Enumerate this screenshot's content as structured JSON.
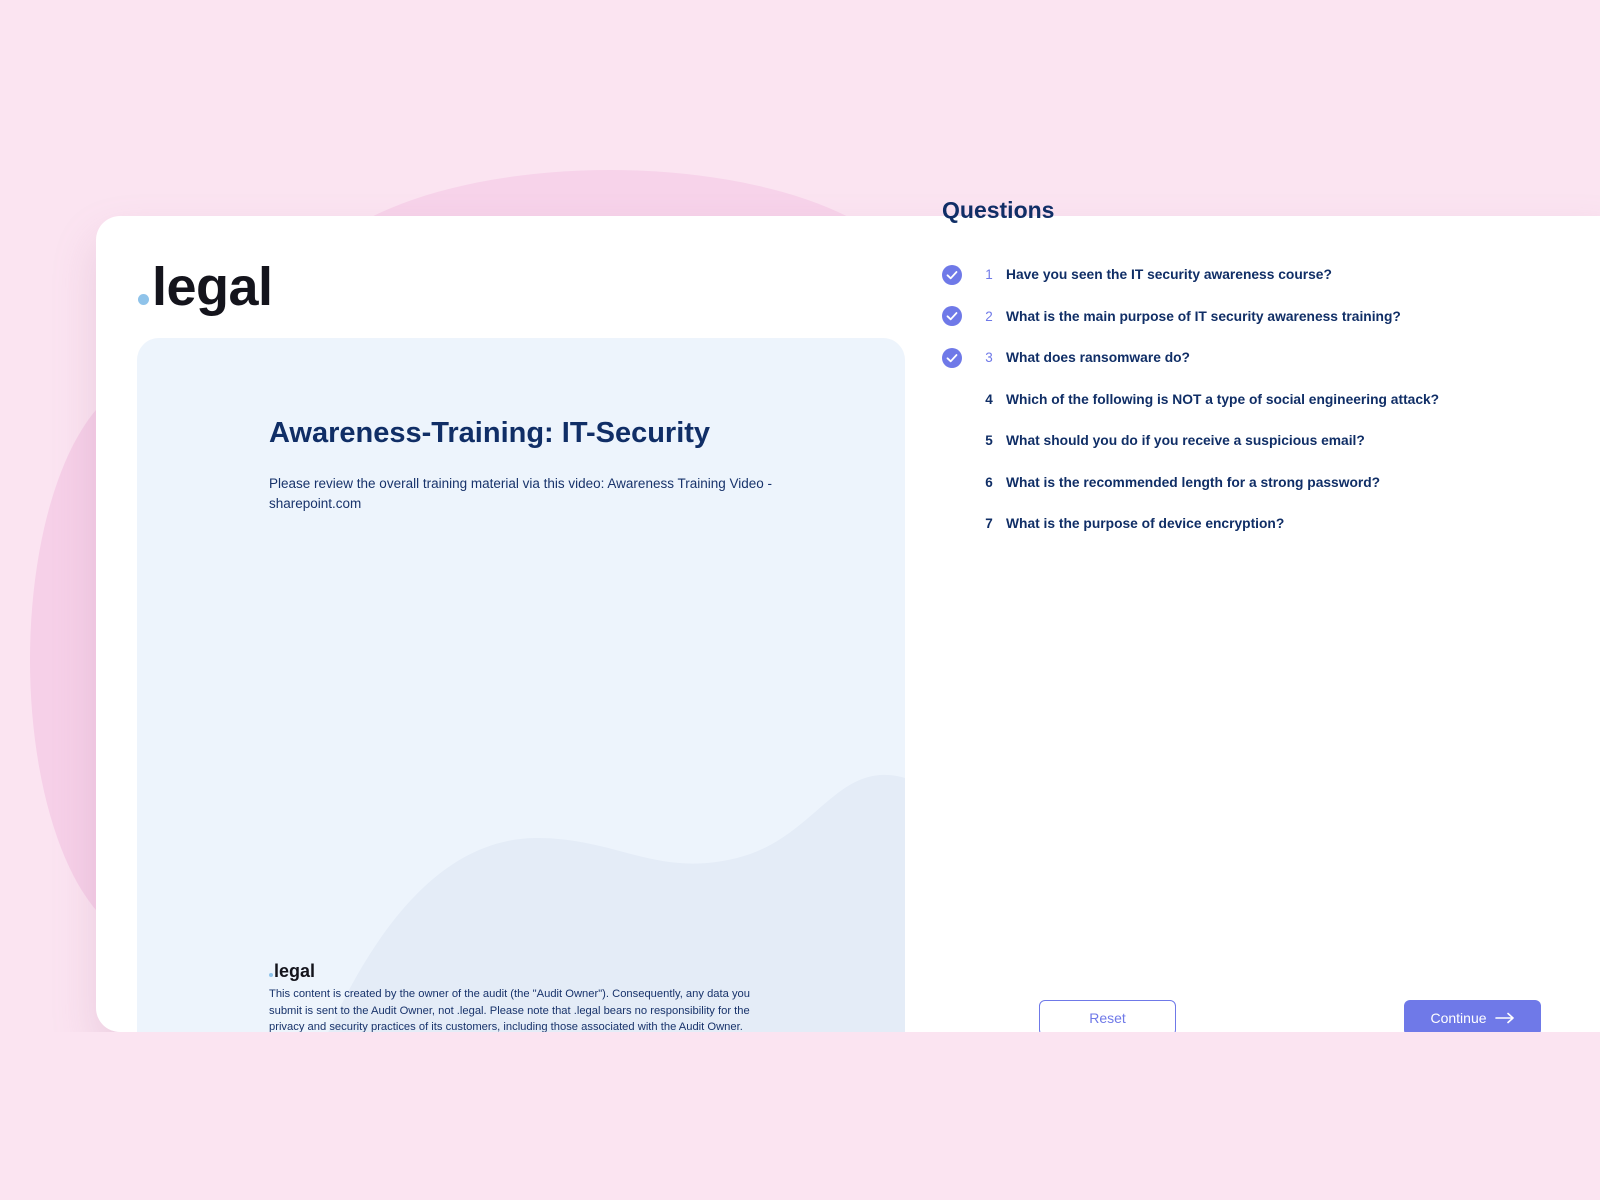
{
  "app": {
    "logo_text": "legal"
  },
  "training": {
    "title": "Awareness-Training: IT-Security",
    "description": "Please review the overall training material via this video: Awareness Training Video - sharepoint.com",
    "footer_logo_text": "legal",
    "disclaimer": "This content is created by the owner of the audit (the \"Audit Owner\"). Consequently, any data you submit is sent to the Audit Owner, not .legal. Please note that .legal bears no responsibility for the privacy and security practices of its customers, including those associated with the Audit Owner."
  },
  "questions": {
    "title": "Questions",
    "items": [
      {
        "number": "1",
        "text": "Have you seen the IT security awareness course?",
        "done": true
      },
      {
        "number": "2",
        "text": "What is the main purpose of IT security awareness training?",
        "done": true
      },
      {
        "number": "3",
        "text": "What does ransomware do?",
        "done": true
      },
      {
        "number": "4",
        "text": "Which of the following is NOT a type of social engineering attack?",
        "done": false
      },
      {
        "number": "5",
        "text": "What should you do if you receive a suspicious email?",
        "done": false
      },
      {
        "number": "6",
        "text": "What is the recommended length for a strong password?",
        "done": false
      },
      {
        "number": "7",
        "text": "What is the purpose of device encryption?",
        "done": false
      }
    ]
  },
  "actions": {
    "reset_label": "Reset",
    "continue_label": "Continue"
  },
  "colors": {
    "background": "#fbe4f1",
    "panel": "#edf4fc",
    "accent": "#6f79e8",
    "heading": "#102e66",
    "logo_dot": "#8fc3ea"
  },
  "icons": {
    "check": "check-circle-icon",
    "arrow": "arrow-right-icon"
  }
}
